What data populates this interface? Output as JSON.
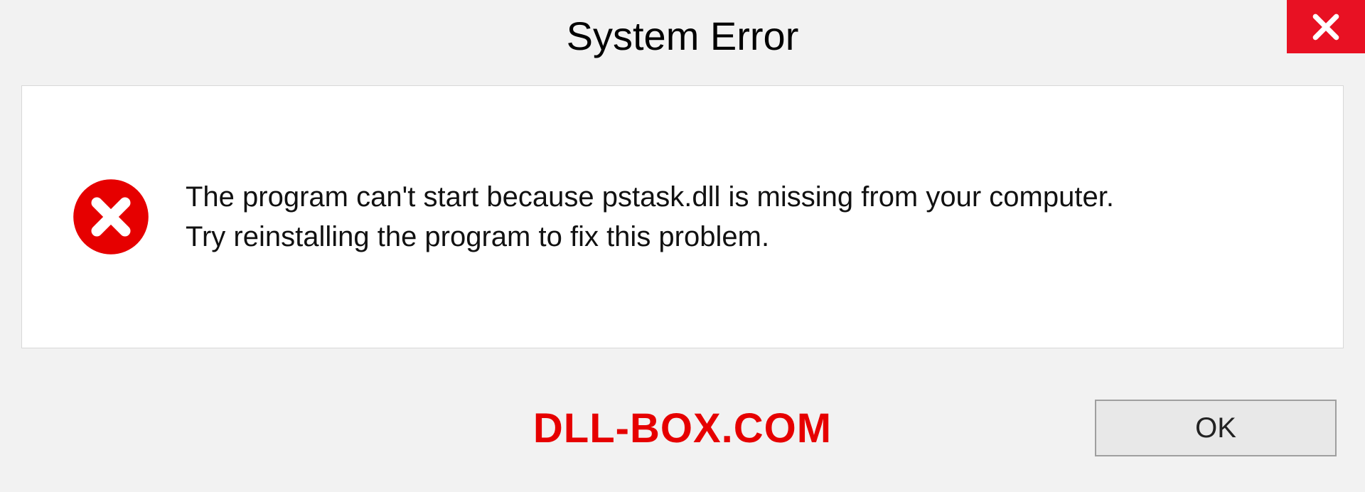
{
  "dialog": {
    "title": "System Error",
    "message_line1": "The program can't start because pstask.dll is missing from your computer.",
    "message_line2": "Try reinstalling the program to fix this problem.",
    "ok_label": "OK"
  },
  "watermark": "DLL-BOX.COM",
  "colors": {
    "close_bg": "#e81123",
    "error_icon": "#e60000",
    "watermark": "#e60000"
  }
}
